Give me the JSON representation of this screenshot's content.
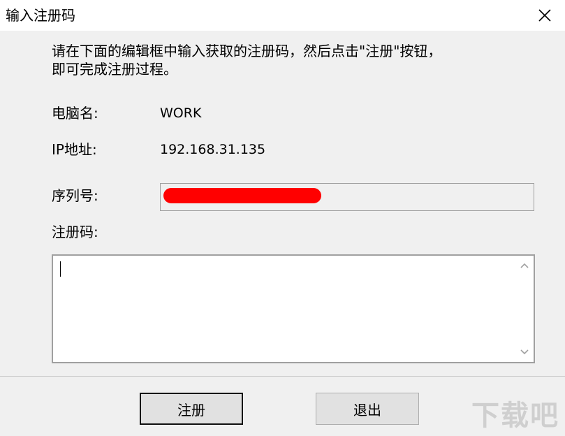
{
  "window": {
    "title": "输入注册码"
  },
  "instructions": {
    "line1": "请在下面的编辑框中输入获取的注册码，然后点击\"注册\"按钮，",
    "line2": "即可完成注册过程。"
  },
  "fields": {
    "computer_name_label": "电脑名:",
    "computer_name_value": "WORK",
    "ip_label": "IP地址:",
    "ip_value": "192.168.31.135",
    "serial_label": "序列号:",
    "serial_value": "",
    "code_label": "注册码:",
    "code_value": ""
  },
  "buttons": {
    "register": "注册",
    "exit": "退出"
  },
  "watermark": "下载吧",
  "colors": {
    "redaction": "#ff0000",
    "dialog_bg": "#f0f0f0"
  }
}
